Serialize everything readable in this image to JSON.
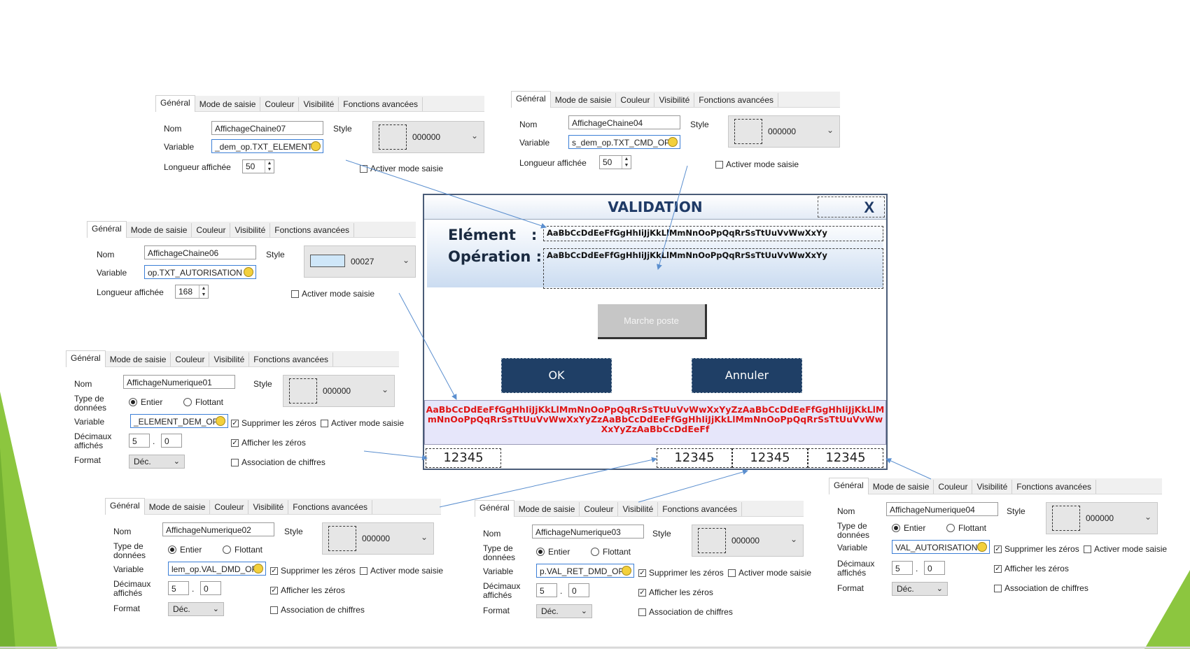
{
  "tabs": [
    "Général",
    "Mode de saisie",
    "Couleur",
    "Visibilité",
    "Fonctions avancées"
  ],
  "labels": {
    "nom": "Nom",
    "variable": "Variable",
    "style": "Style",
    "longueur": "Longueur affichée",
    "activer": "Activer mode saisie",
    "type1": "Type de",
    "type2": "données",
    "entier": "Entier",
    "flottant": "Flottant",
    "supprimer": "Supprimer les zéros",
    "dec1": "Décimaux",
    "dec2": "affichés",
    "afficher": "Afficher les zéros",
    "format": "Format",
    "association": "Association de chiffres"
  },
  "panels": {
    "p07": {
      "nom": "AffichageChaine07",
      "variable": "_dem_op.TXT_ELEMENT",
      "longueur": "50",
      "style_code": "000000"
    },
    "p04": {
      "nom": "AffichageChaine04",
      "variable": "s_dem_op.TXT_CMD_OP",
      "longueur": "50",
      "style_code": "000000"
    },
    "p06": {
      "nom": "AffichageChaine06",
      "variable": "op.TXT_AUTORISATION",
      "longueur": "168",
      "style_code": "00027"
    },
    "n01": {
      "nom": "AffichageNumerique01",
      "variable": "_ELEMENT_DEM_OP",
      "dec_int": "5",
      "dec_frac": "0",
      "format": "Déc.",
      "style_code": "000000"
    },
    "n02": {
      "nom": "AffichageNumerique02",
      "variable": "lem_op.VAL_DMD_OP",
      "dec_int": "5",
      "dec_frac": "0",
      "format": "Déc.",
      "style_code": "000000"
    },
    "n03": {
      "nom": "AffichageNumerique03",
      "variable": "p.VAL_RET_DMD_OP",
      "dec_int": "5",
      "dec_frac": "0",
      "format": "Déc.",
      "style_code": "000000"
    },
    "n04": {
      "nom": "AffichageNumerique04",
      "variable": "VAL_AUTORISATION",
      "dec_int": "5",
      "dec_frac": "0",
      "format": "Déc.",
      "style_code": "000000"
    }
  },
  "dialog": {
    "title": "VALIDATION",
    "close": "X",
    "element_label": "Elément   :",
    "operation_label": "Opération :",
    "element_value": "AaBbCcDdEeFfGgHhIiJjKkLlMmNnOoPpQqRrSsTtUuVvWwXxYy",
    "operation_value": "AaBbCcDdEeFfGgHhIiJjKkLlMmNnOoPpQqRrSsTtUuVvWwXxYy",
    "marche_label": "Marche poste",
    "ok_label": "OK",
    "annuler_label": "Annuler",
    "red_text": "AaBbCcDdEeFfGgHhIiJjKkLlMmNnOoPpQqRrSsTtUuVvWwXxYyZzAaBbCcDdEeFfGgHhIiJjKkLlMmNnOoPpQqRrSsTtUuVvWwXxYyZzAaBbCcDdEeFfGgHhIiJjKkLlMmNnOoPpQqRrSsTtUuVvWwXxYyZzAaBbCcDdEeFf",
    "numbers": [
      "12345",
      "12345",
      "12345",
      "12345"
    ]
  },
  "colors": {
    "accent_green": "#8cc63f",
    "dialog_dark": "#1f3f66",
    "red_text": "#e01515",
    "arrow": "#5b8fcf"
  }
}
